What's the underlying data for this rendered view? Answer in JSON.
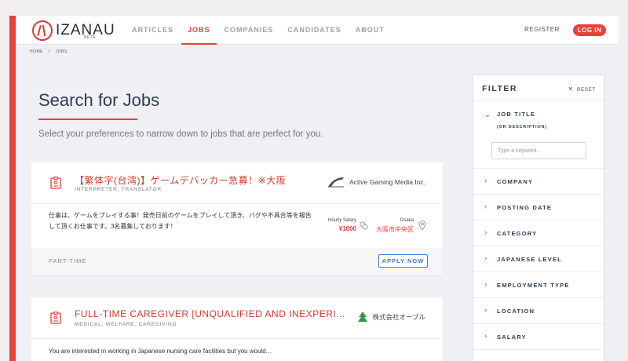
{
  "brand": {
    "name": "IZANAU",
    "badge": "BETA"
  },
  "nav": {
    "items": [
      {
        "label": "ARTICLES",
        "active": false
      },
      {
        "label": "JOBS",
        "active": true
      },
      {
        "label": "COMPANIES",
        "active": false
      },
      {
        "label": "CANDIDATES",
        "active": false
      },
      {
        "label": "ABOUT",
        "active": false
      }
    ],
    "register": "REGISTER",
    "login": "LOG IN"
  },
  "breadcrumb": {
    "home": "HOME",
    "separator": "/",
    "current": "JOBS"
  },
  "page": {
    "title": "Search for Jobs",
    "subtitle": "Select your preferences to narrow down to jobs that are perfect for you."
  },
  "jobs": [
    {
      "title": "【繁体字(台湾)】ゲームデバッカー急募！※大阪",
      "tags": "INTERPRETER, TRANSLATOR",
      "company": "Active Gaming Media Inc.",
      "description": "仕事は、ゲームをプレイする事！発売日前のゲームをプレイして頂き、バグや不具合等を報告して頂くお仕事です。3名募集しております！",
      "salary_label": "Hourly Salary",
      "salary_value": "¥1000",
      "location_label": "Osaka",
      "location_value": "大阪市中央区",
      "type": "PART-TIME",
      "apply": "APPLY NOW"
    },
    {
      "title": "FULL-TIME CAREGIVER [UNQUALIFIED AND INEXPERI...",
      "tags": "MEDICAL, WELFARE, CAREGIVING",
      "company": "株式会社オープル",
      "description": "You are interested in working in Japanese nursing care facilities but you would..."
    }
  ],
  "filter": {
    "title": "FILTER",
    "reset": "RESET",
    "job_title": {
      "label": "JOB TITLE",
      "sublabel": "(OR DESCRIPTION)",
      "placeholder": "Type a keyword..."
    },
    "sections": [
      "COMPANY",
      "POSTING DATE",
      "CATEGORY",
      "JAPANESE LEVEL",
      "EMPLOYMENT TYPE",
      "LOCATION",
      "SALARY"
    ]
  },
  "colors": {
    "accent": "#e5423a",
    "link": "#3a7bd5",
    "heading": "#2e3d4f"
  }
}
